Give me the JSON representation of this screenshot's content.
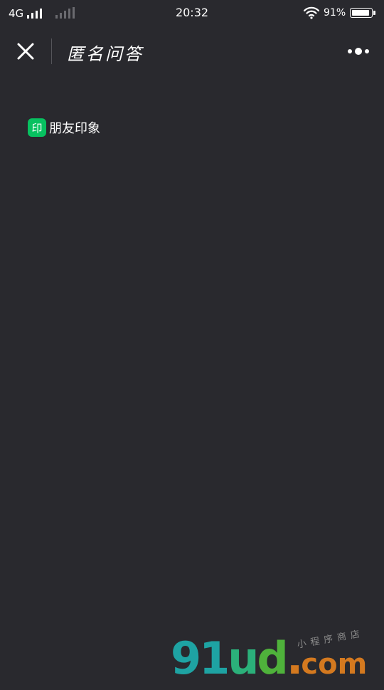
{
  "status_bar": {
    "carrier": "4G",
    "time": "20:32",
    "battery_percent": "91%",
    "battery_level": 0.91
  },
  "nav": {
    "title": "匿名问答",
    "close_icon": "close-icon",
    "more_icon": "more-dots-icon"
  },
  "content": {
    "app_logo_char": "印",
    "app_name": "朋友印象",
    "app_logo_color": "#07c160"
  },
  "watermark": {
    "brand_9": "9",
    "brand_1": "1",
    "brand_u": "u",
    "brand_d": "d",
    "brand_dot": ".",
    "brand_com": "com",
    "subtitle": "小程序商店"
  },
  "colors": {
    "background": "#29292e",
    "text": "#ffffff",
    "accent": "#07c160"
  }
}
